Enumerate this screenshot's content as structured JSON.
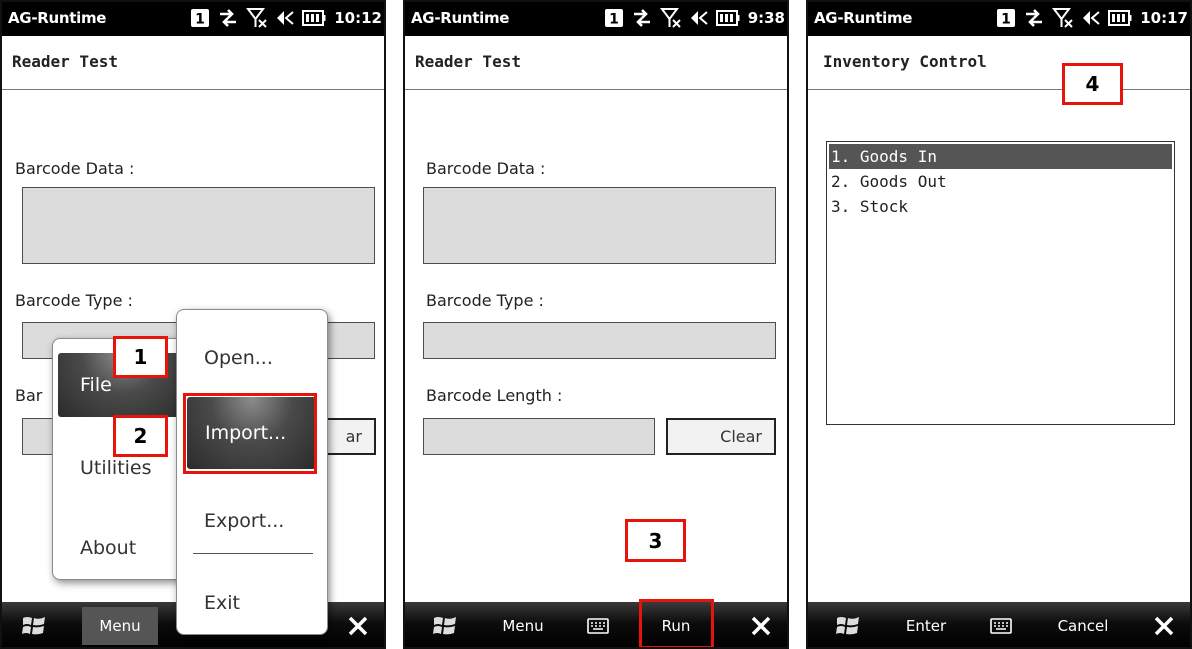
{
  "screens": [
    {
      "status": {
        "app": "AG-Runtime",
        "time": "10:12"
      },
      "title": "Reader Test",
      "labels": {
        "barcode_data": "Barcode Data :",
        "barcode_type": "Barcode Type :",
        "barcode_length_partial": "Bar"
      },
      "clear_partial": "ar",
      "popup_main": {
        "file": "File",
        "utilities": "Utilities",
        "about": "About"
      },
      "popup_sub": {
        "open": "Open...",
        "import": "Import...",
        "export": "Export...",
        "exit": "Exit"
      },
      "taskbar": {
        "menu": "Menu"
      },
      "callouts": [
        "1",
        "2"
      ]
    },
    {
      "status": {
        "app": "AG-Runtime",
        "time": "9:38"
      },
      "title": "Reader Test",
      "labels": {
        "barcode_data": "Barcode Data :",
        "barcode_type": "Barcode Type :",
        "barcode_length": "Barcode Length :"
      },
      "clear_label": "Clear",
      "taskbar": {
        "menu": "Menu",
        "run": "Run"
      },
      "callouts": [
        "3"
      ]
    },
    {
      "status": {
        "app": "AG-Runtime",
        "time": "10:17"
      },
      "title": "Inventory Control",
      "list": [
        "1. Goods In",
        "2. Goods Out",
        "3. Stock"
      ],
      "taskbar": {
        "enter": "Enter",
        "cancel": "Cancel"
      },
      "callouts": [
        "4"
      ]
    }
  ],
  "icons": {
    "status": [
      "sim-slot-1-icon",
      "data-sync-icon",
      "no-signal-icon",
      "volume-icon",
      "battery-icon"
    ],
    "taskbar": [
      "windows-start-icon",
      "keyboard-icon",
      "close-icon"
    ]
  },
  "colors": {
    "callout_border": "#e8140c",
    "status_bg": "#000000",
    "field_bg": "#dcdcdc",
    "selected_item": "#555555"
  }
}
